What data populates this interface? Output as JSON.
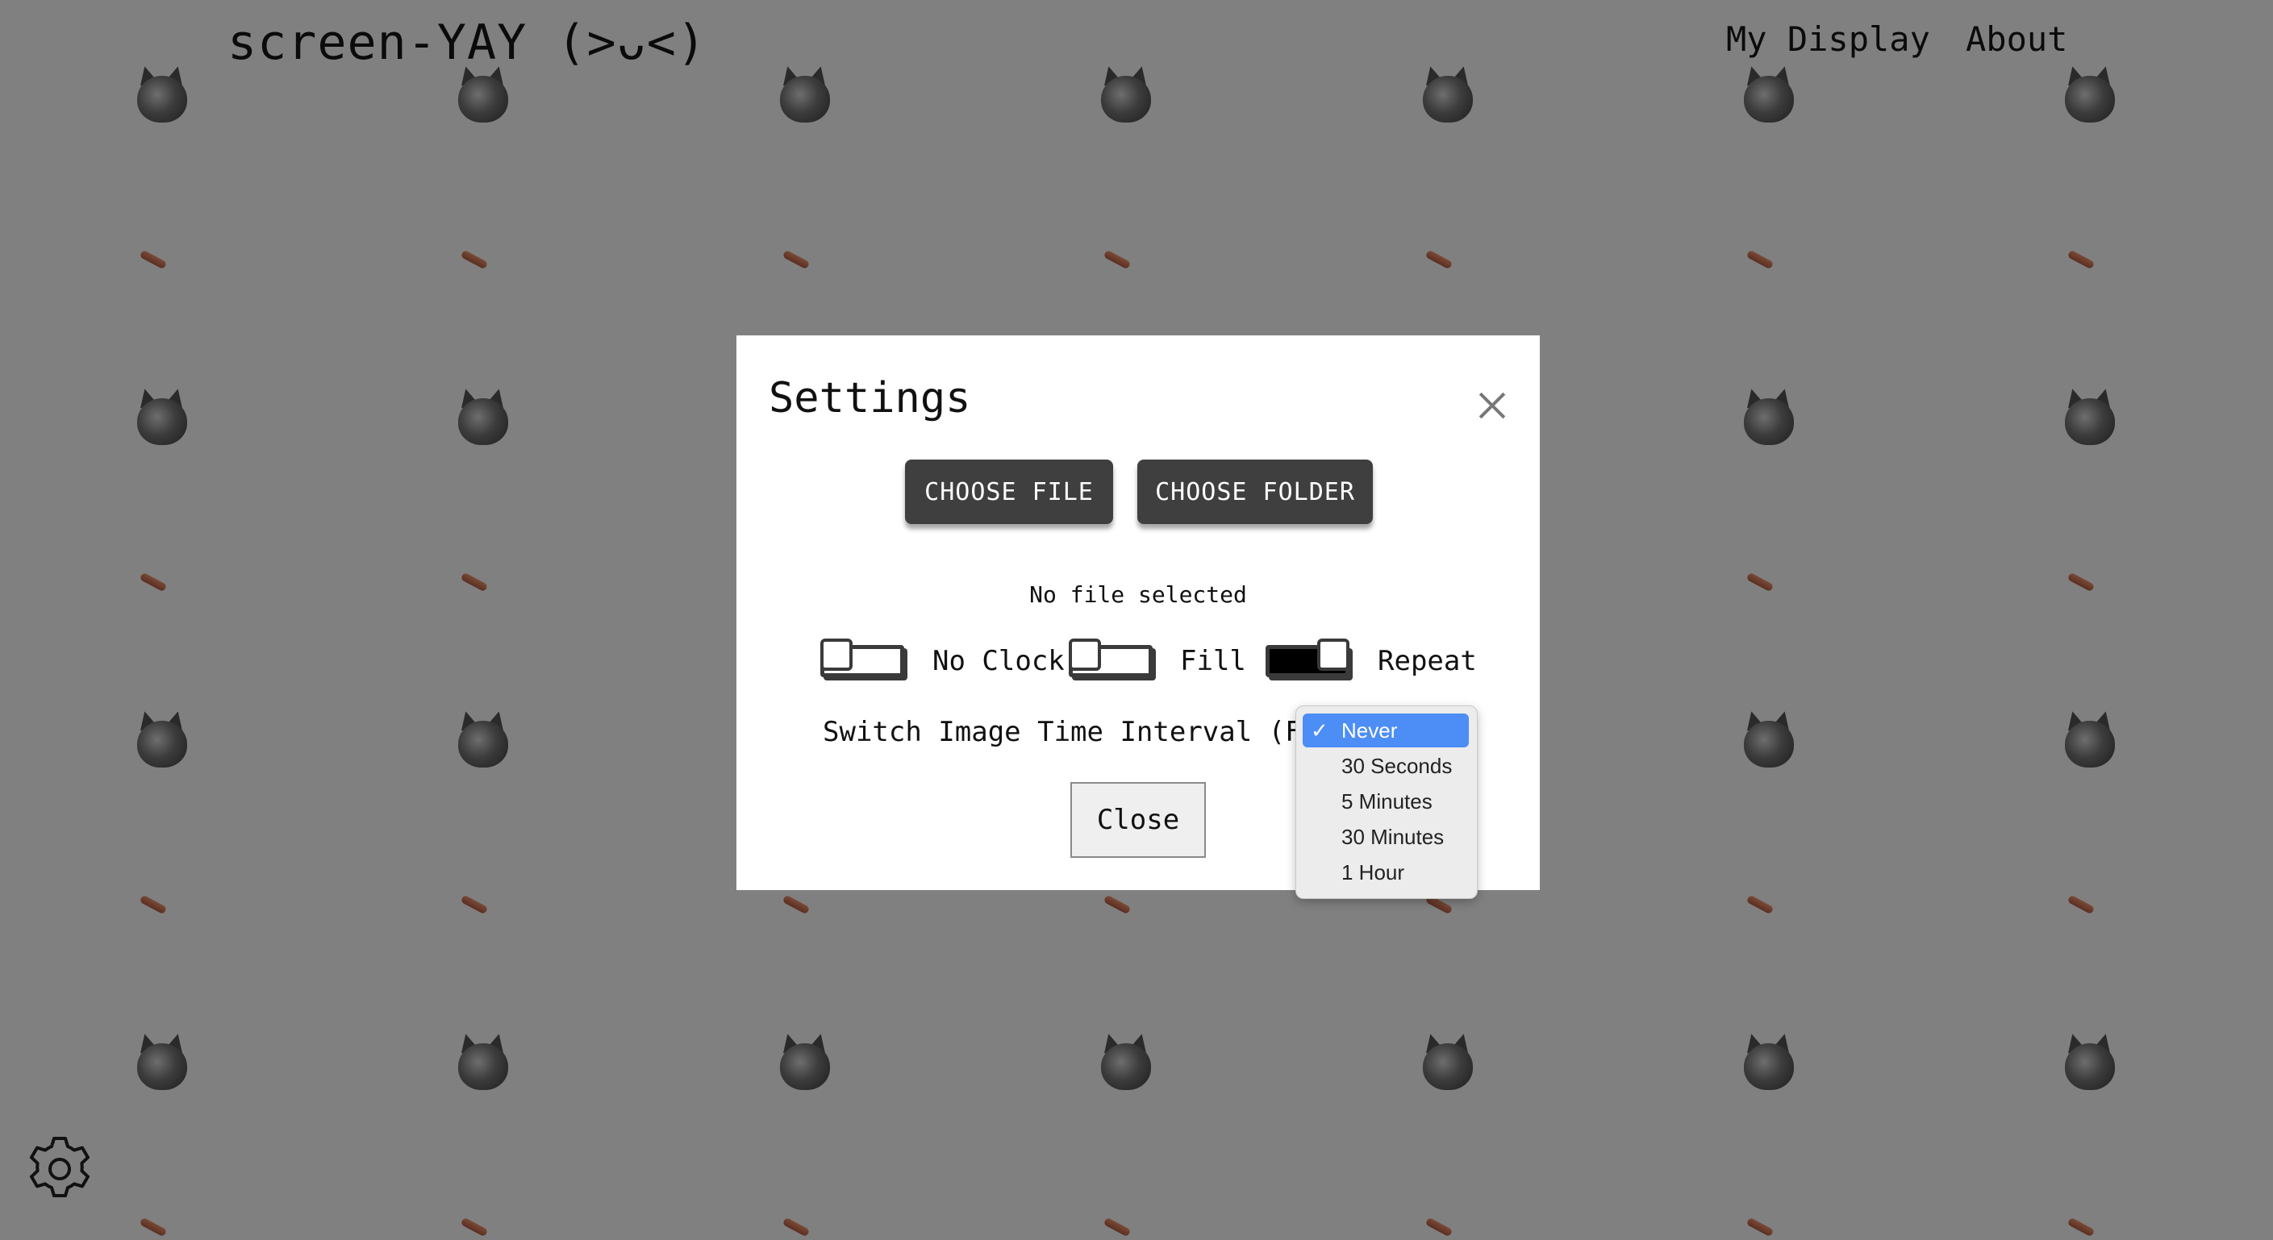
{
  "header": {
    "app_title": "screen-YAY (>ᴗ<)",
    "nav": [
      {
        "label": "My Display"
      },
      {
        "label": "About"
      }
    ]
  },
  "background": {
    "pattern": "tiled cat and stick images",
    "color": "#808080"
  },
  "settings_modal": {
    "title": "Settings",
    "close_icon": "close-x-icon",
    "choose_file_label": "CHOOSE FILE",
    "choose_folder_label": "CHOOSE FOLDER",
    "file_status": "No file selected",
    "toggles": [
      {
        "label": "No Clock",
        "on": false
      },
      {
        "label": "Fill",
        "on": false
      },
      {
        "label": "Repeat",
        "on": true
      }
    ],
    "interval_label": "Switch Image Time Interval (Folder)",
    "close_button_label": "Close"
  },
  "interval_dropdown": {
    "selected": "Never",
    "options": [
      "Never",
      "30 Seconds",
      "5 Minutes",
      "30 Minutes",
      "1 Hour"
    ],
    "check_glyph": "✓",
    "selected_color": "#4c8df6"
  },
  "footer": {
    "settings_icon": "gear-icon"
  }
}
